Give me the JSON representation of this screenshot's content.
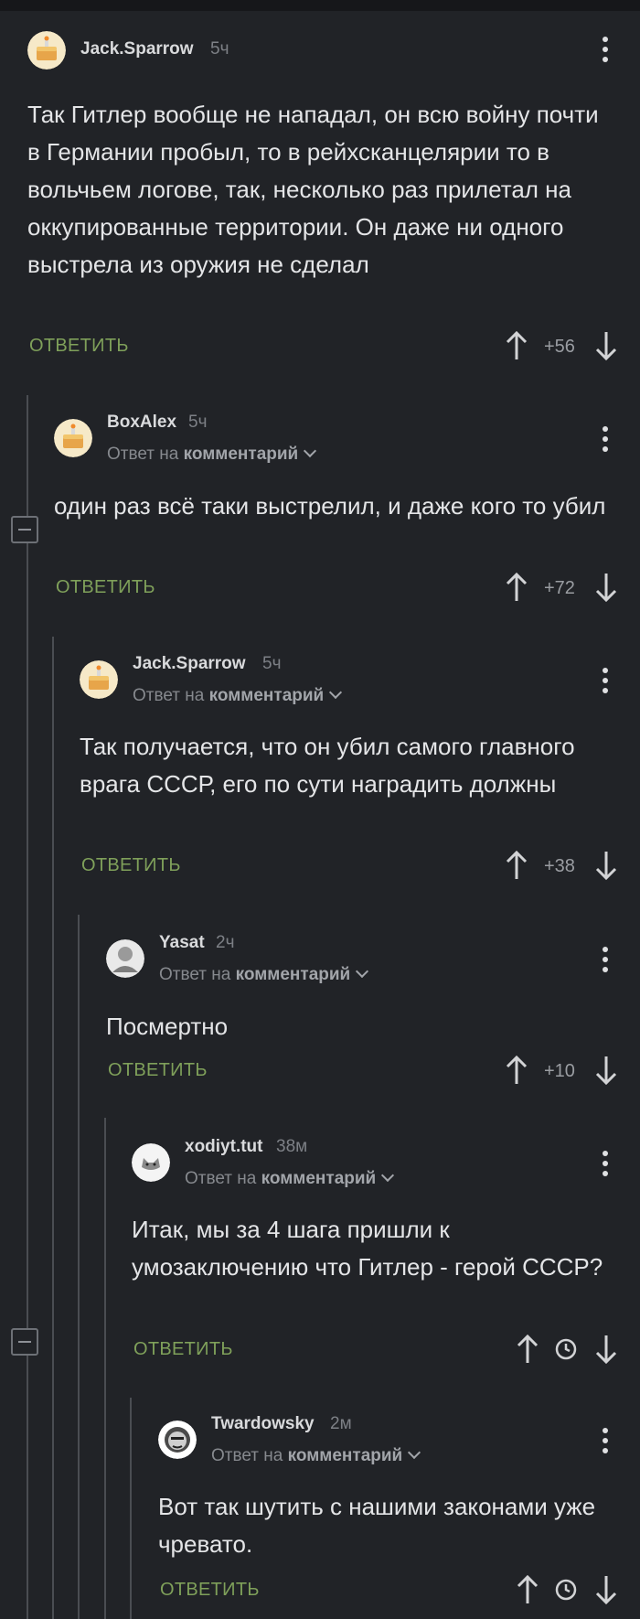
{
  "comments": [
    {
      "author": "Jack.Sparrow",
      "time": "5ч",
      "reply_to": null,
      "text": "Так Гитлер вообще не нападал, он всю войну почти в Германии пробыл, то в рейхсканцелярии то в вольчьем логове, так, несколько раз прилетал на оккупированные территории. Он даже ни одного выстрела из оружия не сделал",
      "reply_label": "ОТВЕТИТЬ",
      "score": "+56",
      "avatar": "cake-avatar"
    },
    {
      "author": "BoxAlex",
      "time": "5ч",
      "reply_prefix": "Ответ на",
      "reply_target": "комментарий",
      "text": "один раз всё таки выстрелил, и даже кого то убил",
      "reply_label": "ОТВЕТИТЬ",
      "score": "+72",
      "avatar": "cake-avatar"
    },
    {
      "author": "Jack.Sparrow",
      "time": "5ч",
      "reply_prefix": "Ответ на",
      "reply_target": "комментарий",
      "text": "Так получается, что он убил самого главного врага СССР, его по сути наградить должны",
      "reply_label": "ОТВЕТИТЬ",
      "score": "+38",
      "avatar": "cake-avatar"
    },
    {
      "author": "Yasat",
      "time": "2ч",
      "reply_prefix": "Ответ на",
      "reply_target": "комментарий",
      "text": "Посмертно",
      "reply_label": "ОТВЕТИТЬ",
      "score": "+10",
      "avatar": "photo-avatar"
    },
    {
      "author": "xodiyt.tut",
      "time": "38м",
      "reply_prefix": "Ответ на",
      "reply_target": "комментарий",
      "text": "Итак, мы за 4 шага пришли к умозаключению что Гитлер - герой СССР?",
      "reply_label": "ОТВЕТИТЬ",
      "score": null,
      "avatar": "cat-avatar"
    },
    {
      "author": "Twardowsky",
      "time": "2м",
      "reply_prefix": "Ответ на",
      "reply_target": "комментарий",
      "text": "Вот так шутить с нашими законами уже чревато.",
      "reply_label": "ОТВЕТИТЬ",
      "score": null,
      "avatar": "face-avatar"
    }
  ],
  "colors": {
    "background": "#212327",
    "reply_button": "#7fa05a",
    "thread_line": "#4a4d52"
  }
}
